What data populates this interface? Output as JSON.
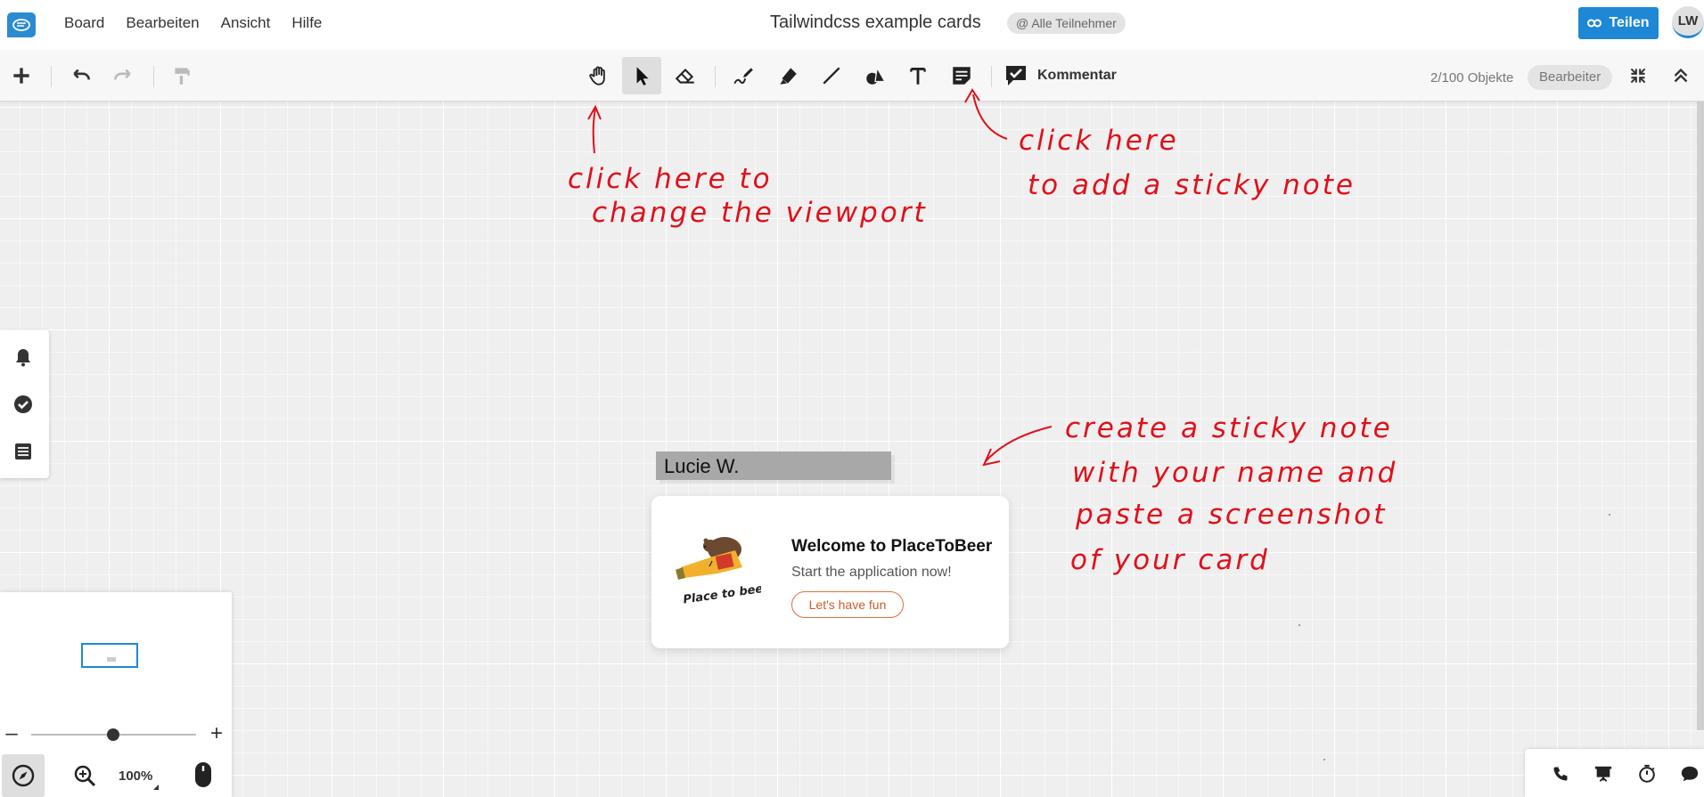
{
  "menubar": {
    "logo_icon": "board-chat-logo",
    "menu_items": [
      "Board",
      "Bearbeiten",
      "Ansicht",
      "Hilfe"
    ],
    "board_title": "Tailwindcss example cards",
    "participants_label": "@ Alle Teilnehmer",
    "share_label": "Teilen",
    "avatar_initials": "LW",
    "accent_color": "#1e88d6"
  },
  "toolbar": {
    "left_tools": [
      "add-icon",
      "undo-icon",
      "redo-icon",
      "format-painter-icon"
    ],
    "center_tools": [
      "hand-icon",
      "pointer-icon",
      "eraser-icon",
      "pen-icon",
      "marker-icon",
      "line-icon",
      "shapes-icon",
      "text-icon",
      "sticky-note-icon"
    ],
    "active_tool": "pointer-icon",
    "comment_label": "Kommentar",
    "object_count": "2/100 Objekte",
    "role_label": "Bearbeiter"
  },
  "left_panel": {
    "icons": [
      "bell-icon",
      "check-circle-icon",
      "list-icon"
    ]
  },
  "navigator": {
    "zoom_minus": "–",
    "zoom_plus": "+",
    "zoom_level": "100%",
    "slider_value": 0.5
  },
  "canvas": {
    "name_note": "Lucie W.",
    "card": {
      "logo_caption": "Place to beer",
      "title": "Welcome to PlaceToBeer",
      "subtitle": "Start the application now!",
      "button": "Let's have fun"
    },
    "annotations": {
      "viewport_line1": "click here to",
      "viewport_line2": "change the viewport",
      "sticky_line1": "click here",
      "sticky_line2": "to add a sticky note",
      "create_line1": "create a sticky note",
      "create_line2": "with your name and",
      "create_line3": "paste a screenshot",
      "create_line4": "of your card"
    },
    "ink_color": "#e0101a"
  },
  "bottom_right": {
    "icons": [
      "phone-icon",
      "presentation-icon",
      "timer-icon",
      "chat-icon"
    ]
  }
}
